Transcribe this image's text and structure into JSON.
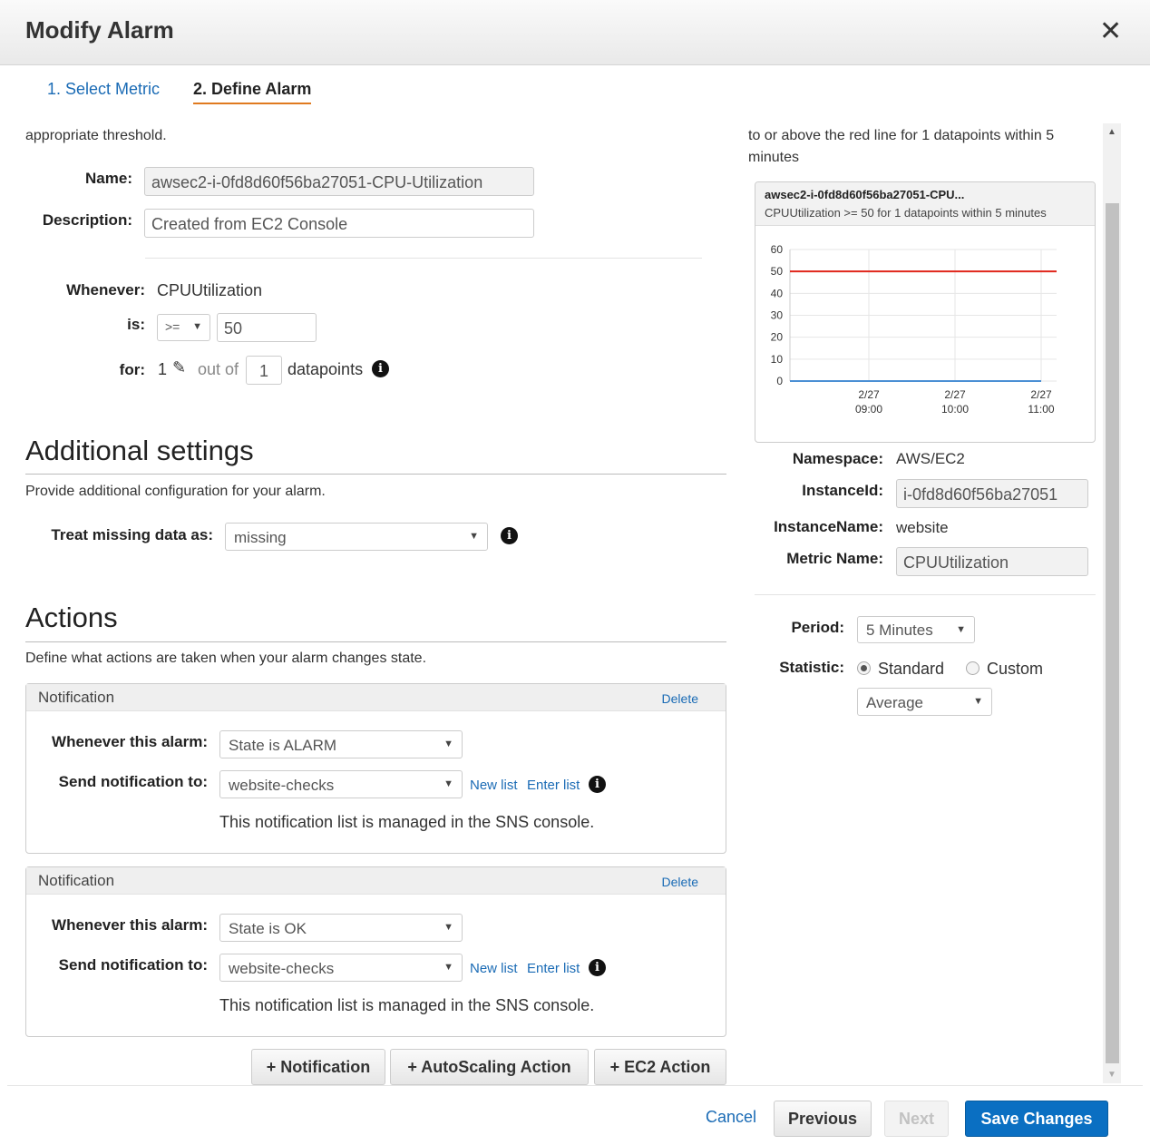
{
  "dialog": {
    "title": "Modify Alarm",
    "close_glyph": "✕"
  },
  "steps": {
    "step1": "1. Select Metric",
    "step2": "2. Define Alarm"
  },
  "left_intro": "appropriate threshold.",
  "alarm": {
    "name_label": "Name:",
    "name_value": "awsec2-i-0fd8d60f56ba27051-CPU-Utilization",
    "description_label": "Description:",
    "description_value": "Created from EC2 Console",
    "whenever_label": "Whenever:",
    "whenever_value": "CPUUtilization",
    "is_label": "is:",
    "operator": ">=",
    "threshold": "50",
    "for_label": "for:",
    "for_count": "1",
    "out_of_text": "out of",
    "out_of_value": "1",
    "datapoints_text": "datapoints"
  },
  "additional": {
    "heading": "Additional settings",
    "description": "Provide additional configuration for your alarm.",
    "treat_label": "Treat missing data as:",
    "treat_value": "missing"
  },
  "actions": {
    "heading": "Actions",
    "description": "Define what actions are taken when your alarm changes state.",
    "notifications": [
      {
        "title": "Notification",
        "delete": "Delete",
        "whenever_label": "Whenever this alarm:",
        "state": "State is ALARM",
        "send_label": "Send notification to:",
        "target": "website-checks",
        "new_list": "New list",
        "enter_list": "Enter list",
        "note": "This notification list is managed in the SNS console."
      },
      {
        "title": "Notification",
        "delete": "Delete",
        "whenever_label": "Whenever this alarm:",
        "state": "State is OK",
        "send_label": "Send notification to:",
        "target": "website-checks",
        "new_list": "New list",
        "enter_list": "Enter list",
        "note": "This notification list is managed in the SNS console."
      }
    ],
    "buttons": {
      "add_notification": "+ Notification",
      "add_autoscaling": "+ AutoScaling Action",
      "add_ec2": "+ EC2 Action"
    }
  },
  "right_intro": {
    "line1": "to or above the red line for 1 datapoints within 5",
    "line2": "minutes"
  },
  "chart_panel": {
    "title": "awsec2-i-0fd8d60f56ba27051-CPU...",
    "subtitle": "CPUUtilization >= 50 for 1 datapoints within 5 minutes"
  },
  "chart_data": {
    "type": "line",
    "title": "awsec2-i-0fd8d60f56ba27051-CPU...",
    "subtitle": "CPUUtilization >= 50 for 1 datapoints within 5 minutes",
    "ylim": [
      0,
      60
    ],
    "y_ticks": [
      "60",
      "50",
      "40",
      "30",
      "20",
      "10",
      "0"
    ],
    "x_ticks": [
      {
        "date": "2/27",
        "time": "09:00"
      },
      {
        "date": "2/27",
        "time": "10:00"
      },
      {
        "date": "2/27",
        "time": "11:00"
      }
    ],
    "threshold": 50,
    "threshold_color": "#e0261b",
    "series": [
      {
        "color": "#4a8fd4",
        "x": [
          "2/27 08:30",
          "2/27 11:00"
        ],
        "values": [
          0,
          0
        ]
      }
    ],
    "grid": true
  },
  "metric": {
    "namespace_label": "Namespace:",
    "namespace_value": "AWS/EC2",
    "instanceid_label": "InstanceId:",
    "instanceid_value": "i-0fd8d60f56ba27051",
    "instancename_label": "InstanceName:",
    "instancename_value": "website",
    "metricname_label": "Metric Name:",
    "metricname_value": "CPUUtilization"
  },
  "period": {
    "label": "Period:",
    "value": "5 Minutes"
  },
  "statistic": {
    "label": "Statistic:",
    "standard": "Standard",
    "custom": "Custom",
    "value": "Average"
  },
  "footer": {
    "cancel": "Cancel",
    "previous": "Previous",
    "next": "Next",
    "save": "Save Changes"
  },
  "colors": {
    "link": "#1a6bb5",
    "primary": "#0a6fc2",
    "tab_underline": "#e07a1f"
  }
}
